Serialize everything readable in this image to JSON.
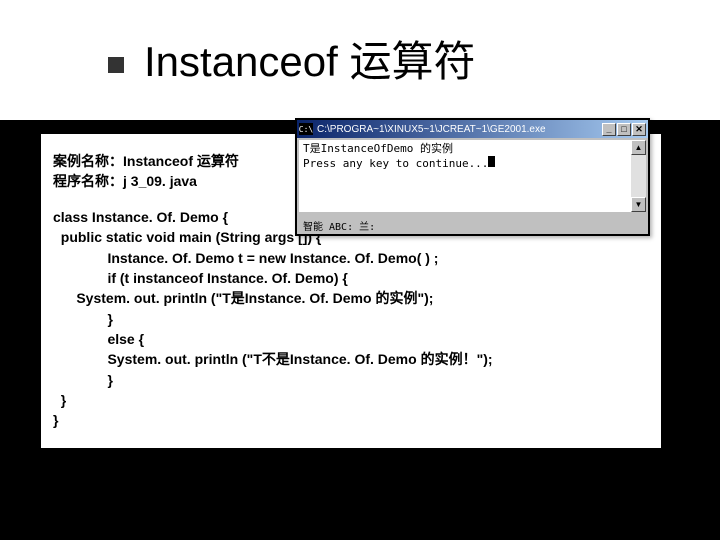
{
  "slide": {
    "title": "Instanceof 运算符"
  },
  "meta": {
    "caseNameLabel": "案例名称：",
    "caseNameValue": "Instanceof 运算符",
    "programNameLabel": "程序名称：",
    "programNameValue": "j 3_09. java"
  },
  "code": {
    "lines": [
      "class Instance. Of. Demo {",
      "  public static void main (String args []) {",
      "              Instance. Of. Demo t = new Instance. Of. Demo( ) ;",
      "              if (t instanceof Instance. Of. Demo) {",
      "      System. out. println (\"T是Instance. Of. Demo 的实例\");",
      "              }",
      "              else {",
      "              System. out. println (\"T不是Instance. Of. Demo 的实例！\");",
      "              }",
      "  }",
      "}"
    ]
  },
  "console": {
    "title": "C:\\PROGRA~1\\XINUX5~1\\JCREAT~1\\GE2001.exe",
    "iconGlyph": "C:\\",
    "output": {
      "line1": "T是InstanceOfDemo 的实例",
      "line2": "Press any key to continue..."
    },
    "ime": "智能 ABC: 兰:",
    "buttons": {
      "minimize": "_",
      "maximize": "□",
      "close": "✕"
    },
    "scroll": {
      "up": "▲",
      "down": "▼"
    }
  }
}
